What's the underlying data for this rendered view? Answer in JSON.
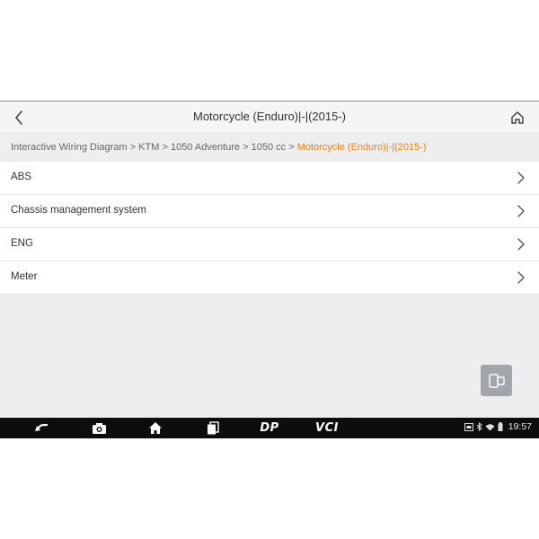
{
  "header": {
    "title": "Motorcycle (Enduro)|-|(2015-)"
  },
  "breadcrumb": {
    "items": [
      "Interactive Wiring Diagram",
      "KTM",
      "1050 Adventure",
      "1050 cc"
    ],
    "current": "Motorcycle (Enduro)|-|(2015-)",
    "separator": ">"
  },
  "list": {
    "items": [
      {
        "label": "ABS"
      },
      {
        "label": "Chassis management system"
      },
      {
        "label": "ENG"
      },
      {
        "label": "Meter"
      }
    ]
  },
  "navbar": {
    "buttons": [
      "back-icon",
      "camera-icon",
      "home-icon",
      "recent-apps-icon",
      "dp-icon",
      "vci-icon"
    ],
    "dp_label": "DP",
    "vci_label": "VCI"
  },
  "status": {
    "time": "19:57",
    "icons": [
      "screenshot-icon",
      "bluetooth-icon",
      "wifi-icon",
      "battery-icon"
    ]
  },
  "colors": {
    "accent": "#e8821e",
    "background": "#eeeef0",
    "navbar": "#0d0d0d"
  }
}
